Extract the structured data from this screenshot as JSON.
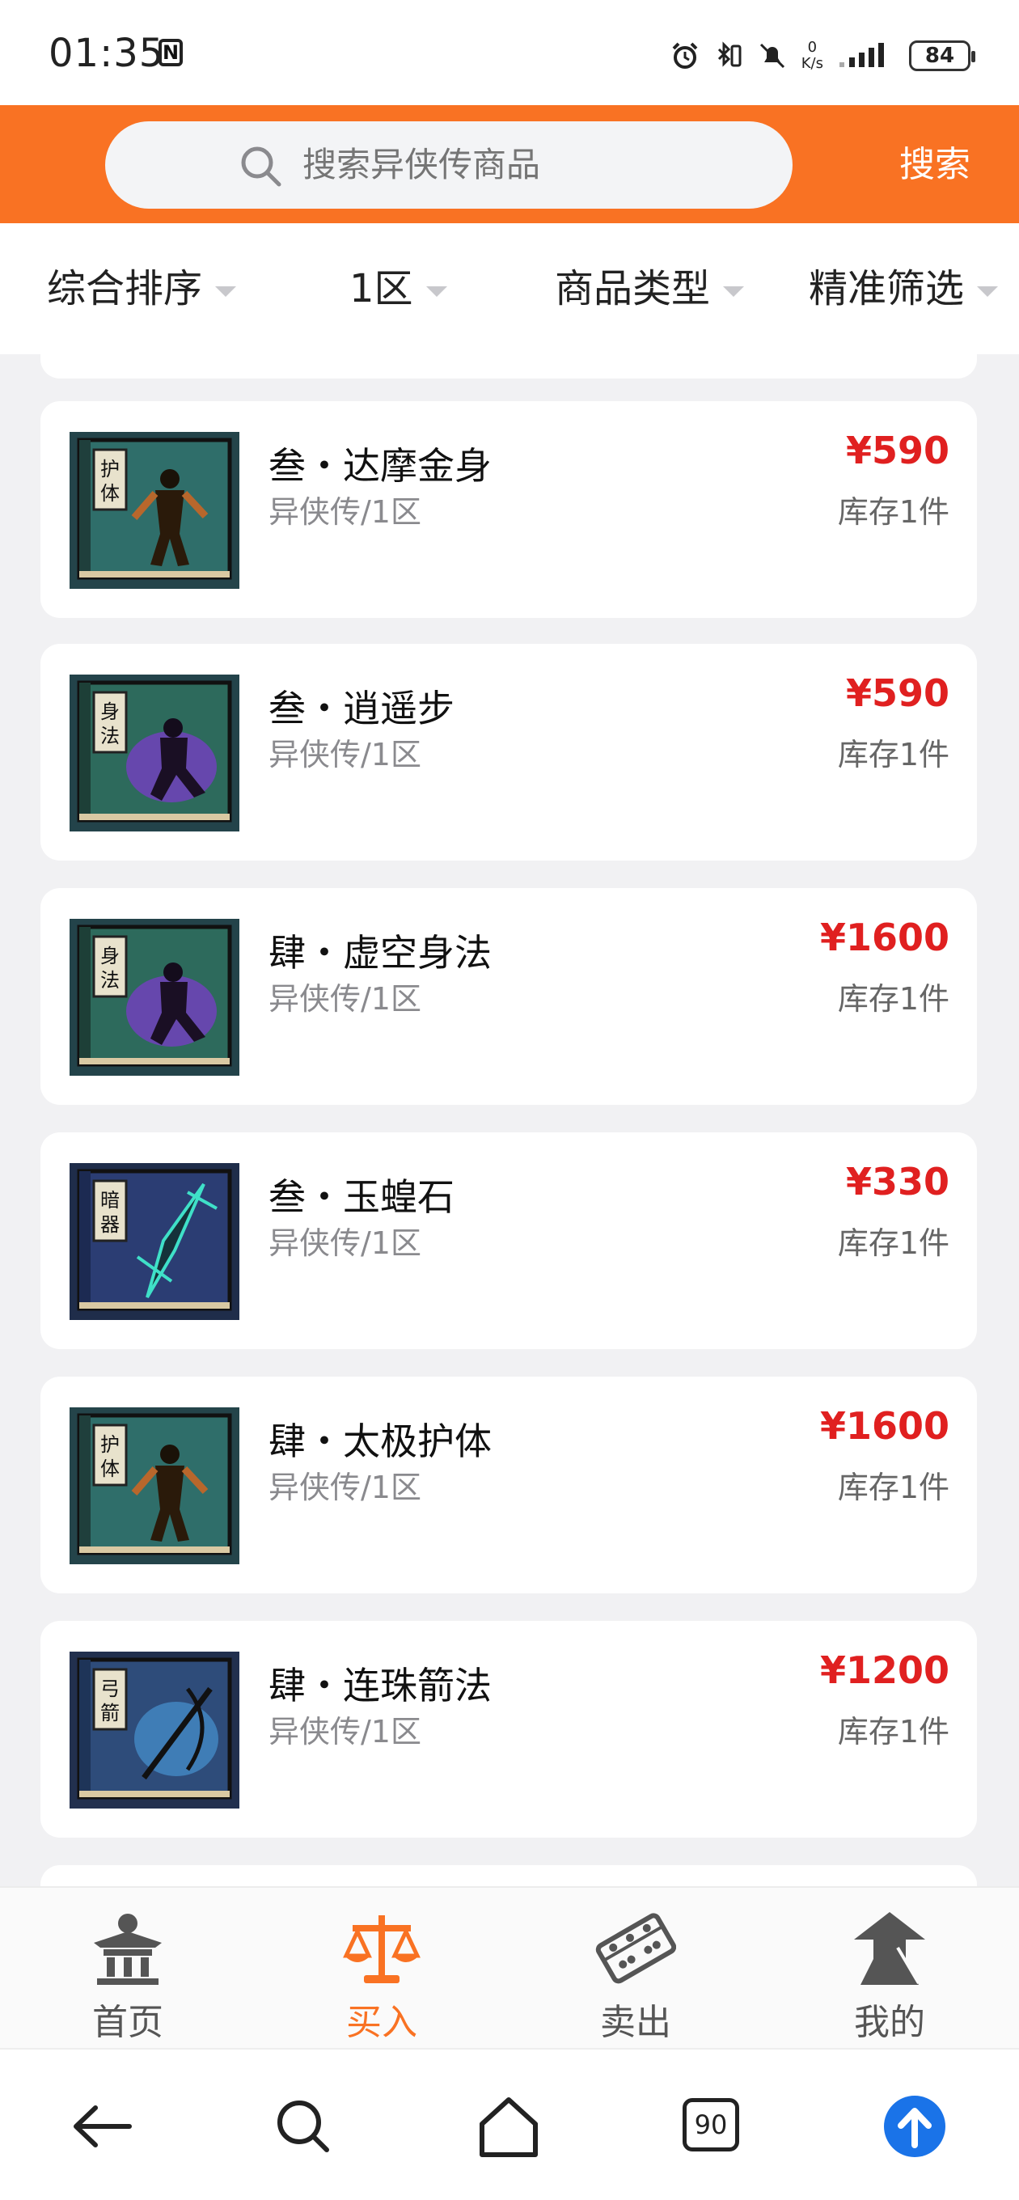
{
  "status_bar": {
    "time": "01:35",
    "net_speed_value": "0",
    "net_speed_unit": "K/s",
    "battery": "84"
  },
  "search": {
    "placeholder": "搜索异侠传商品",
    "button": "搜索"
  },
  "filters": [
    {
      "label": "综合排序"
    },
    {
      "label": "1区"
    },
    {
      "label": "商品类型"
    },
    {
      "label": "精准筛选"
    }
  ],
  "products": [
    {
      "title": "叁・达摩金身",
      "subtitle": "异侠传/1区",
      "price": "¥590",
      "stock": "库存1件",
      "icon": "protect-manual-icon",
      "book_color": "#2f6e6a"
    },
    {
      "title": "叁・逍遥步",
      "subtitle": "异侠传/1区",
      "price": "¥590",
      "stock": "库存1件",
      "icon": "movement-manual-icon",
      "book_color": "#2d6a5c"
    },
    {
      "title": "肆・虚空身法",
      "subtitle": "异侠传/1区",
      "price": "¥1600",
      "stock": "库存1件",
      "icon": "movement-manual-icon",
      "book_color": "#2d6a5c"
    },
    {
      "title": "叁・玉蝗石",
      "subtitle": "异侠传/1区",
      "price": "¥330",
      "stock": "库存1件",
      "icon": "hidden-weapon-manual-icon",
      "book_color": "#2b3d73"
    },
    {
      "title": "肆・太极护体",
      "subtitle": "异侠传/1区",
      "price": "¥1600",
      "stock": "库存1件",
      "icon": "protect-manual-icon",
      "book_color": "#2f6e6a"
    },
    {
      "title": "肆・连珠箭法",
      "subtitle": "异侠传/1区",
      "price": "¥1200",
      "stock": "库存1件",
      "icon": "archery-manual-icon",
      "book_color": "#2e4c7a"
    }
  ],
  "tabs": [
    {
      "label": "首页",
      "icon": "home-temple-icon"
    },
    {
      "label": "买入",
      "icon": "scales-icon",
      "active": true
    },
    {
      "label": "卖出",
      "icon": "abacus-icon"
    },
    {
      "label": "我的",
      "icon": "swordsman-avatar-icon"
    }
  ],
  "system_nav": {
    "tab_count": "90"
  },
  "colors": {
    "accent": "#f97223",
    "price": "#e02020",
    "page_bg": "#f1f1f3"
  }
}
